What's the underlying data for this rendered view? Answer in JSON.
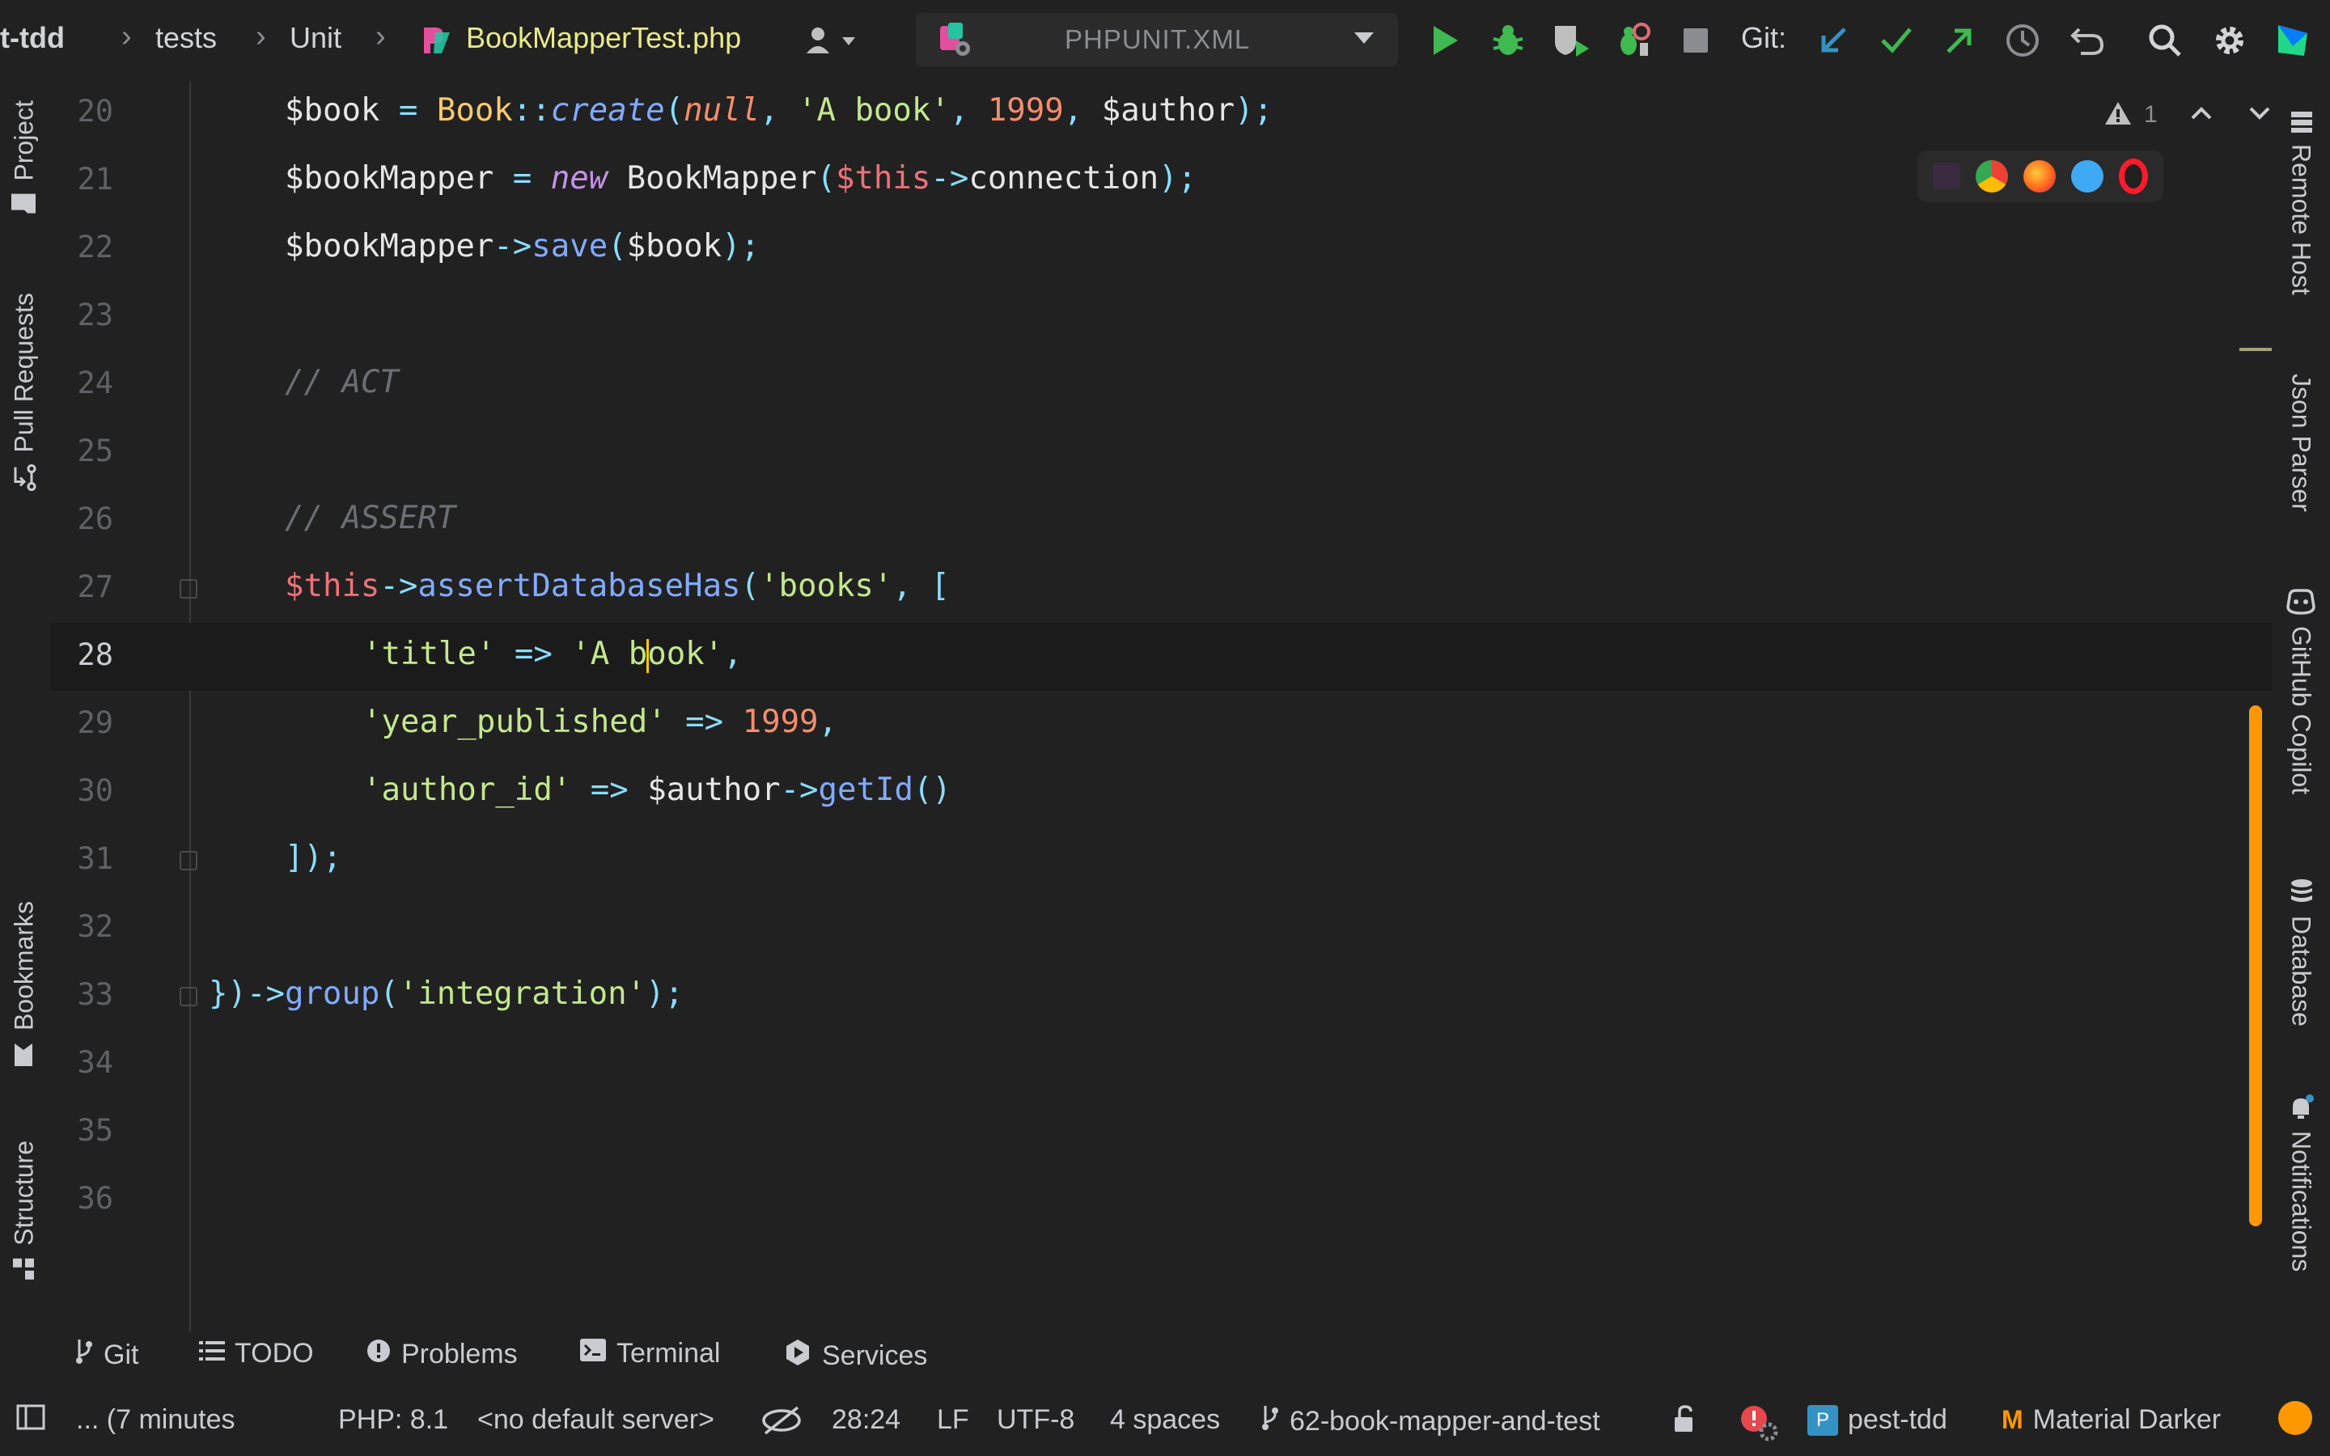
{
  "toolbar": {
    "breadcrumb": {
      "project": "t-tdd",
      "folder1": "tests",
      "folder2": "Unit",
      "file": "BookMapperTest.php"
    },
    "run_config": "PHPUNIT.XML",
    "git_label": "Git:"
  },
  "left_tools": {
    "project": "Project",
    "pull_requests": "Pull Requests",
    "bookmarks": "Bookmarks",
    "structure": "Structure"
  },
  "right_tools": {
    "remote_host": "Remote Host",
    "json_parser": "Json Parser",
    "github_copilot": "GitHub Copilot",
    "database": "Database",
    "notifications": "Notifications"
  },
  "editor": {
    "inspection_count": "1",
    "lines": {
      "20": "20",
      "21": "21",
      "22": "22",
      "23": "23",
      "24": "24",
      "25": "25",
      "26": "26",
      "27": "27",
      "28": "28",
      "29": "29",
      "30": "30",
      "31": "31",
      "32": "32",
      "33": "33",
      "34": "34",
      "35": "35",
      "36": "36"
    },
    "code": {
      "l20": {
        "var": "$book",
        "eq": " = ",
        "cls": "Book",
        "op": "::",
        "fn": "create",
        "p1": "(",
        "nul": "null",
        "c1": ", ",
        "s1": "'A book'",
        "c2": ", ",
        "n1": "1999",
        "c3": ", ",
        "v2": "$author",
        "end": ");"
      },
      "l21": {
        "var": "$bookMapper",
        "eq": " = ",
        "kw": "new",
        "sp": " ",
        "cls": "BookMapper",
        "p1": "(",
        "this": "$this",
        "arrow": "->",
        "prop": "connection",
        "end": ");"
      },
      "l22": {
        "var": "$bookMapper",
        "arrow": "->",
        "fn": "save",
        "p1": "(",
        "v2": "$book",
        "end": ");"
      },
      "l24": "// ACT",
      "l26": "// ASSERT",
      "l27": {
        "this": "$this",
        "arrow": "->",
        "fn": "assertDatabaseHas",
        "p1": "(",
        "s1": "'books'",
        "c1": ", ",
        "br": "["
      },
      "l28": {
        "s1": "'title'",
        "op": " => ",
        "s2a": "'A b",
        "s2b": "ook'",
        "c1": ","
      },
      "l29": {
        "s1": "'year_published'",
        "op": " => ",
        "n1": "1999",
        "c1": ","
      },
      "l30": {
        "s1": "'author_id'",
        "op": " => ",
        "v1": "$author",
        "arrow": "->",
        "fn": "getId",
        "p": "()"
      },
      "l31": {
        "br": "]",
        "end": ");"
      },
      "l33": {
        "br": "})",
        "arrow": "->",
        "fn": "group",
        "p1": "(",
        "s1": "'integration'",
        "end": ");"
      }
    }
  },
  "bottom_tabs": {
    "git": "Git",
    "todo": "TODO",
    "problems": "Problems",
    "terminal": "Terminal",
    "services": "Services"
  },
  "status": {
    "message": "... (7 minutes",
    "php": "PHP: 8.1",
    "server": "<no default server>",
    "position": "28:24",
    "line_sep": "LF",
    "encoding": "UTF-8",
    "indent": "4 spaces",
    "branch": "62-book-mapper-and-test",
    "project_badge": "P",
    "project": "pest-tdd",
    "theme_badge": "M",
    "theme": "Material Darker"
  },
  "colors": {
    "background": "#212121",
    "accent": "#ff9800",
    "run": "#3fb950",
    "git_update": "#3592c4",
    "git_push": "#3fb950"
  }
}
